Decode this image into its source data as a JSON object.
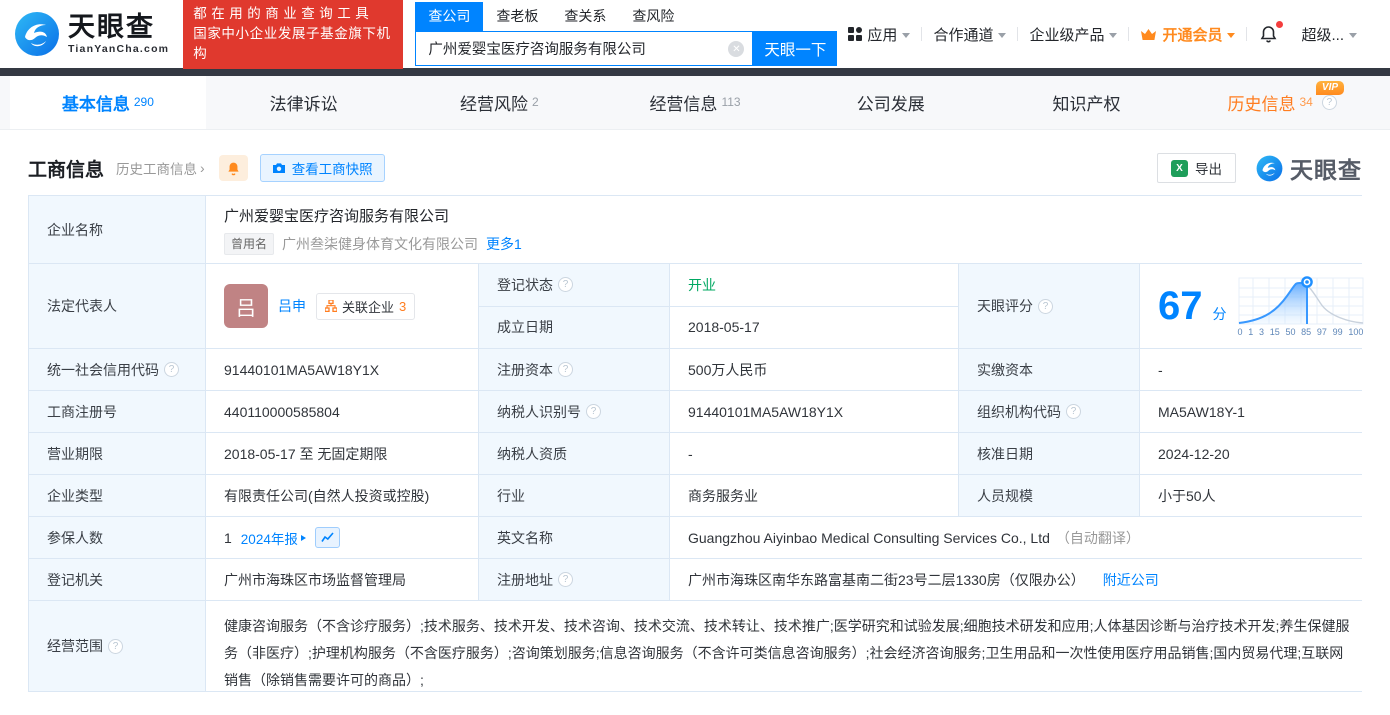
{
  "colors": {
    "brand_blue": "#0084ff",
    "banner_red": "#e0392e",
    "vip_orange": "#ff8a1e",
    "status_green": "#00a862"
  },
  "brand": {
    "name": "天眼查",
    "domain": "TianYanCha.com",
    "slogan_line1": "都在用的商业查询工具",
    "slogan_line2": "国家中小企业发展子基金旗下机构"
  },
  "search": {
    "tabs": [
      "查公司",
      "查老板",
      "查关系",
      "查风险"
    ],
    "value": "广州爱婴宝医疗咨询服务有限公司",
    "button": "天眼一下"
  },
  "top_nav": {
    "items": [
      "应用",
      "合作通道",
      "企业级产品",
      "开通会员",
      "超级..."
    ]
  },
  "tabs": [
    {
      "label": "基本信息",
      "count": "290"
    },
    {
      "label": "法律诉讼",
      "count": ""
    },
    {
      "label": "经营风险",
      "count": "2"
    },
    {
      "label": "经营信息",
      "count": "113"
    },
    {
      "label": "公司发展",
      "count": ""
    },
    {
      "label": "知识产权",
      "count": ""
    },
    {
      "label": "历史信息",
      "count": "34",
      "vip": "VIP"
    }
  ],
  "section": {
    "title": "工商信息",
    "history_link": "历史工商信息",
    "snapshot_button": "查看工商快照",
    "export_button": "导出",
    "watermark": "天眼查"
  },
  "table": {
    "company_name_label": "企业名称",
    "company_name": "广州爱婴宝医疗咨询服务有限公司",
    "former_name_tag": "曾用名",
    "former_name": "广州叁柒健身体育文化有限公司",
    "more_link": "更多1",
    "legal_rep_label": "法定代表人",
    "legal_rep_avatar": "吕",
    "legal_rep_name": "吕申",
    "related_label": "关联企业",
    "related_count": "3",
    "reg_status_label": "登记状态",
    "reg_status": "开业",
    "est_date_label": "成立日期",
    "est_date": "2018-05-17",
    "score_label": "天眼评分",
    "score": "67",
    "score_unit": "分",
    "score_ticks": [
      "0",
      "1",
      "3",
      "15",
      "50",
      "85",
      "97",
      "99",
      "100"
    ],
    "uscc_label": "统一社会信用代码",
    "uscc": "91440101MA5AW18Y1X",
    "reg_capital_label": "注册资本",
    "reg_capital": "500万人民币",
    "paid_capital_label": "实缴资本",
    "paid_capital": "-",
    "reg_number_label": "工商注册号",
    "reg_number": "440110000585804",
    "taxpayer_id_label": "纳税人识别号",
    "taxpayer_id": "91440101MA5AW18Y1X",
    "org_code_label": "组织机构代码",
    "org_code": "MA5AW18Y-1",
    "business_term_label": "营业期限",
    "business_term": "2018-05-17 至 无固定期限",
    "taxpayer_quality_label": "纳税人资质",
    "taxpayer_quality": "-",
    "approval_date_label": "核准日期",
    "approval_date": "2024-12-20",
    "company_type_label": "企业类型",
    "company_type": "有限责任公司(自然人投资或控股)",
    "industry_label": "行业",
    "industry": "商务服务业",
    "staff_size_label": "人员规模",
    "staff_size": "小于50人",
    "insured_label": "参保人数",
    "insured_count": "1",
    "annual_report_link": "2024年报",
    "english_name_label": "英文名称",
    "english_name": "Guangzhou Aiyinbao Medical Consulting Services Co., Ltd",
    "english_name_note": "（自动翻译）",
    "reg_authority_label": "登记机关",
    "reg_authority": "广州市海珠区市场监督管理局",
    "address_label": "注册地址",
    "address": "广州市海珠区南华东路富基南二街23号二层1330房（仅限办公）",
    "nearby_link": "附近公司",
    "business_scope_label": "经营范围",
    "business_scope": "健康咨询服务（不含诊疗服务）;技术服务、技术开发、技术咨询、技术交流、技术转让、技术推广;医学研究和试验发展;细胞技术研发和应用;人体基因诊断与治疗技术开发;养生保健服务（非医疗）;护理机构服务（不含医疗服务）;咨询策划服务;信息咨询服务（不含许可类信息咨询服务）;社会经济咨询服务;卫生用品和一次性使用医疗用品销售;国内贸易代理;互联网销售（除销售需要许可的商品）;"
  }
}
